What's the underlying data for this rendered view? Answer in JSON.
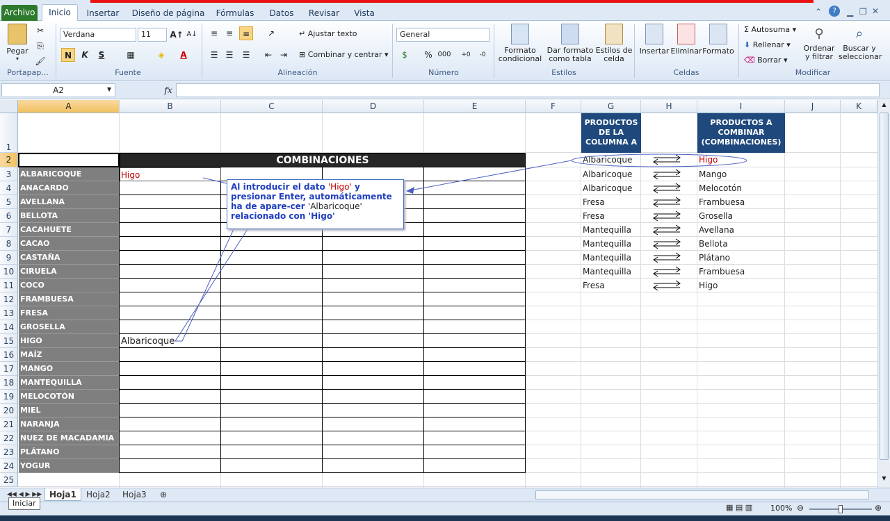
{
  "ribbon_tabs": [
    "Archivo",
    "Inicio",
    "Insertar",
    "Diseño de página",
    "Fórmulas",
    "Datos",
    "Revisar",
    "Vista"
  ],
  "clipboard": {
    "paste": "Pegar",
    "group": "Portapap..."
  },
  "font": {
    "name": "Verdana",
    "size": "11",
    "bold": "N",
    "italic": "K",
    "underline": "S",
    "group": "Fuente"
  },
  "alignment": {
    "wrap": "Ajustar texto",
    "merge": "Combinar y centrar",
    "group": "Alineación"
  },
  "number": {
    "format": "General",
    "percent": "%",
    "thousands": "000",
    "group": "Número"
  },
  "styles": {
    "conditional": "Formato condicional",
    "as_table": "Dar formato como tabla",
    "cell_styles": "Estilos de celda",
    "group": "Estilos"
  },
  "cells": {
    "insert": "Insertar",
    "delete": "Eliminar",
    "format": "Formato",
    "group": "Celdas"
  },
  "editing": {
    "autosum": "Autosuma",
    "fill": "Rellenar",
    "clear": "Borrar",
    "sort": "Ordenar y filtrar",
    "find": "Buscar y seleccionar",
    "group": "Modificar"
  },
  "formula_bar": {
    "name_box": "A2",
    "fx": "fx",
    "value": ""
  },
  "columns": [
    "A",
    "B",
    "C",
    "D",
    "E",
    "F",
    "G",
    "H",
    "I",
    "J",
    "K"
  ],
  "rows": [
    "1",
    "2",
    "3",
    "4",
    "5",
    "6",
    "7",
    "8",
    "9",
    "10",
    "11",
    "12",
    "13",
    "14",
    "15",
    "16",
    "17",
    "18",
    "19",
    "20",
    "21",
    "22",
    "23",
    "24",
    "25"
  ],
  "table_title": "COMBINACIONES",
  "products": [
    "ALBARICOQUE",
    "ANACARDO",
    "AVELLANA",
    "BELLOTA",
    "CACAHUETE",
    "CACAO",
    "CASTAÑA",
    "CIRUELA",
    "COCO",
    "FRAMBUESA",
    "FRESA",
    "GROSELLA",
    "HIGO",
    "MAÍZ",
    "MANGO",
    "MANTEQUILLA",
    "MELOCOTÓN",
    "MIEL",
    "NARANJA",
    "NUEZ DE MACADAMIA",
    "PLÁTANO",
    "YOGUR"
  ],
  "b3_value": "Higo",
  "b15_value": "Albaricoque",
  "callout": {
    "p1": "Al introducir el dato ",
    "q1": "'Higo'",
    "p2": " y presionar Enter, automáticamente ha de apare-cer ",
    "q2": "'Albaricoque'",
    "p3": " relacionado con ",
    "q3": "'Higo'"
  },
  "header_g": "PRODUCTOS DE LA COLUMNA A",
  "header_i": "PRODUCTOS A COMBINAR (COMBINACIONES)",
  "col_g": [
    "Albaricoque",
    "Albaricoque",
    "Albaricoque",
    "Fresa",
    "Fresa",
    "Mantequilla",
    "Mantequilla",
    "Mantequilla",
    "Mantequilla",
    "Fresa"
  ],
  "col_i": [
    "Higo",
    "Mango",
    "Melocotón",
    "Frambuesa",
    "Grosella",
    "Avellana",
    "Bellota",
    "Plátano",
    "Frambuesa",
    "Higo"
  ],
  "sheet_tabs": [
    "Hoja1",
    "Hoja2",
    "Hoja3"
  ],
  "status": {
    "mode": "Iniciar",
    "zoom": "100%"
  },
  "colors": {
    "accent_red": "#e81010",
    "header_blue": "#1f497d",
    "product_gray": "#7f7f7f",
    "callout_blue": "#1f3fbf"
  }
}
